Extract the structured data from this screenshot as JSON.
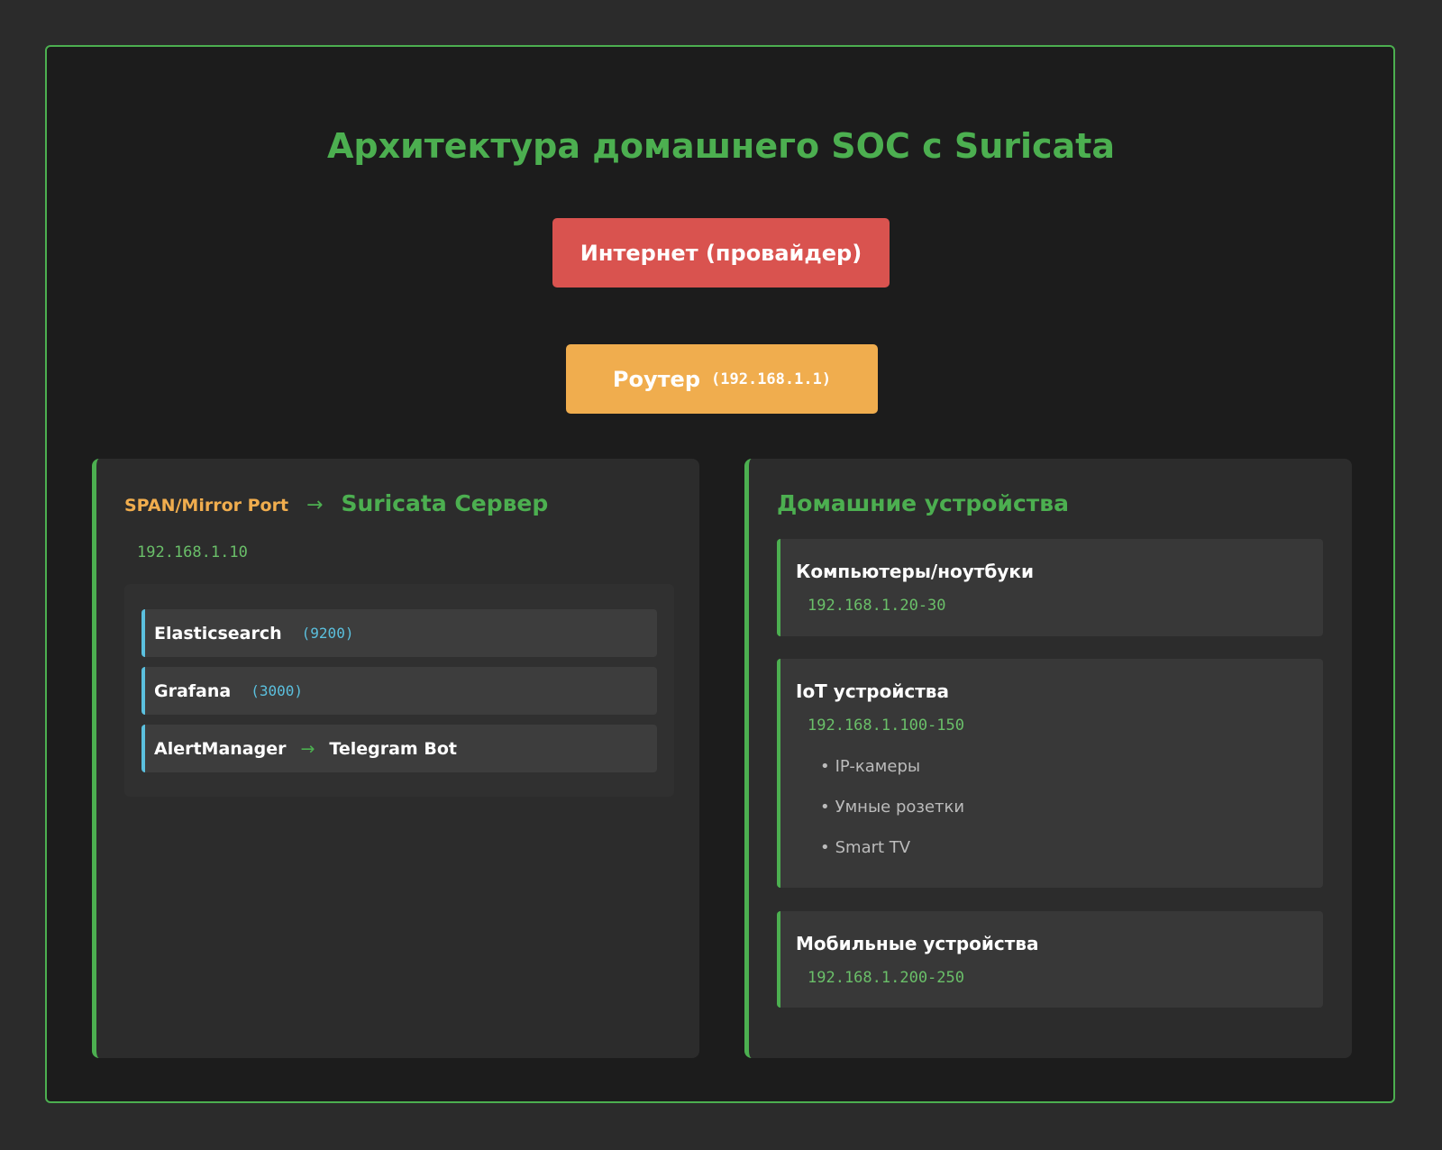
{
  "title": "Архитектура домашнего SOC с Suricata",
  "internet": {
    "label": "Интернет (провайдер)"
  },
  "router": {
    "label": "Роутер",
    "ip": "(192.168.1.1)"
  },
  "suricata_panel": {
    "span_label": "SPAN/Mirror Port",
    "arrow": "→",
    "server_label": "Suricata Сервер",
    "ip": "192.168.1.10",
    "services": [
      {
        "name": "Elasticsearch",
        "port": "(9200)"
      },
      {
        "name": "Grafana",
        "port": "(3000)"
      },
      {
        "name": "AlertManager",
        "arrow": "→",
        "target": "Telegram Bot"
      }
    ]
  },
  "devices_panel": {
    "title": "Домашние устройства",
    "groups": [
      {
        "name": "Компьютеры/ноутбуки",
        "ip": "192.168.1.20-30",
        "items": []
      },
      {
        "name": "IoT устройства",
        "ip": "192.168.1.100-150",
        "items": [
          "IP-камеры",
          "Умные розетки",
          "Smart TV"
        ]
      },
      {
        "name": "Мобильные устройства",
        "ip": "192.168.1.200-250",
        "items": []
      }
    ]
  },
  "colors": {
    "accent": "#4caf50",
    "internet": "#d9534f",
    "router": "#f0ad4e",
    "service_border": "#5bc0de",
    "background": "#2b2b2b",
    "frame_background": "#1c1c1c"
  }
}
